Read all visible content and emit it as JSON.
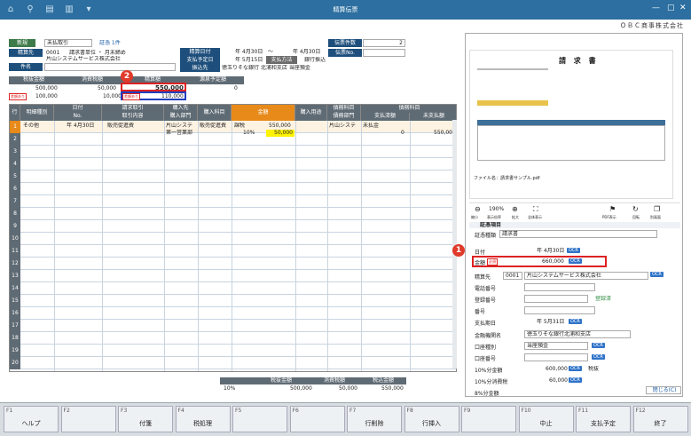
{
  "window": {
    "title": "精算伝票",
    "company": "ＯＢＣ商事株式会社"
  },
  "header": {
    "new_label": "新規",
    "voucher_type": "未払取引",
    "evidence_link": "証憑 1件",
    "voucher_count_label": "伝票件数",
    "voucher_count": "2",
    "voucher_no_label": "伝票No.",
    "partner_label": "精算先",
    "partner_code": "0001",
    "partner_unit": "請求書単位 ・ 月末締め",
    "partner_name": "片山システムサービス株式会社",
    "subject_label": "件名",
    "slip_date_label": "精算日付",
    "date_from": "年  4月30日",
    "tilde": "～",
    "date_to": "年  4月30日",
    "pay_date_label": "支払予定日",
    "pay_date": "年  5月15日",
    "pay_method_label": "支払方法",
    "pay_method": "銀行振込",
    "transfer_label": "振込先",
    "transfer": "徳玉りそな銀行 北浦和支店 当座預金"
  },
  "totals": {
    "h1": "税抜金額",
    "h2": "消費税額",
    "h3": "精算額",
    "h4": "源泉予定額",
    "v1": "500,000",
    "v2": "50,000",
    "v3": "550,000",
    "v4": "0",
    "diff_label": "差額あり",
    "r1": "100,000",
    "r2": "10,000",
    "r3": "110,000"
  },
  "grid": {
    "headers": {
      "row": "行",
      "kind": "明細種別",
      "date": "日付",
      "no": "No.",
      "req": "請求取引",
      "content": "取引内容",
      "dept_top": "購入先",
      "dept": "購入部門",
      "item": "購入科目",
      "amount": "金額",
      "purpose": "購入用途",
      "liab_top": "債務科目",
      "liab_dept": "債務部門",
      "liab": "債務科目",
      "pay": "支払済額",
      "unpaid": "未支払額"
    },
    "row1": {
      "num": "1",
      "kind": "その他",
      "date": "年  4月30日",
      "content": "販売促進費",
      "dept1": "片山システ",
      "dept2": "第一営業部",
      "item": "販売促進費",
      "tax": "課税",
      "rate": "10%",
      "amount": "550,000",
      "tax_amount": "50,000",
      "liab_dept": "片山システ",
      "liab": "未払金",
      "pay": "0",
      "unpaid": "550,000"
    },
    "row_numbers": [
      "1",
      "2",
      "3",
      "4",
      "5",
      "6",
      "7",
      "8",
      "9",
      "10",
      "11",
      "12",
      "13",
      "14",
      "15",
      "16",
      "17",
      "18",
      "19",
      "20"
    ]
  },
  "footer_summary": {
    "h1": "税抜金額",
    "h2": "消費税額",
    "h3": "税込金額",
    "rate": "10%",
    "v1": "500,000",
    "v2": "50,000",
    "v3": "550,000"
  },
  "preview": {
    "title": "請 求 書",
    "file_label": "ファイル名：請求書サンプル.pdf",
    "zoom_label": "190%",
    "tools": [
      "縮小",
      "表示倍率",
      "拡大",
      "全体表示",
      "PDF表示",
      "回転",
      "別画面"
    ]
  },
  "evidence": {
    "section": "証憑項目",
    "type_label": "証憑種類",
    "type_value": "請求書",
    "date_label": "日付",
    "date_value": "年  4月30日",
    "amount_label": "金額",
    "amount_value": "660,000",
    "partner_label": "精算先",
    "partner_code": "0001",
    "partner_name": "片山システムサービス株式会社",
    "phone_label": "電話番号",
    "reg_label": "登録番号",
    "reg_link": "登録済",
    "no_label": "番号",
    "due_label": "支払期日",
    "due_value": "年  5月31日",
    "bank_label": "金融機関名",
    "bank_value": "徳玉りそな銀行北浦和支店",
    "acct_type_label": "口座種別",
    "acct_type_value": "当座預金",
    "acct_no_label": "口座番号",
    "t10_label": "10%分金額",
    "t10_value": "600,000",
    "t10_extra": "税抜",
    "tax10_label": "10%分消費税",
    "tax10_value": "60,000",
    "t8_label": "8%分金額",
    "ok": "OCR",
    "required": "必須",
    "close_label": "閉じる(C)"
  },
  "badges": {
    "b1": "1",
    "b2": "2"
  },
  "fkeys": [
    {
      "key": "F1",
      "label": "ヘルプ"
    },
    {
      "key": "F2",
      "label": ""
    },
    {
      "key": "F3",
      "label": "付箋"
    },
    {
      "key": "F4",
      "label": "税処理"
    },
    {
      "key": "F5",
      "label": ""
    },
    {
      "key": "F6",
      "label": ""
    },
    {
      "key": "F7",
      "label": "行削除"
    },
    {
      "key": "F8",
      "label": "行挿入"
    },
    {
      "key": "F9",
      "label": ""
    },
    {
      "key": "F10",
      "label": "中止"
    },
    {
      "key": "F11",
      "label": "支払予定"
    },
    {
      "key": "F12",
      "label": "終了"
    }
  ]
}
